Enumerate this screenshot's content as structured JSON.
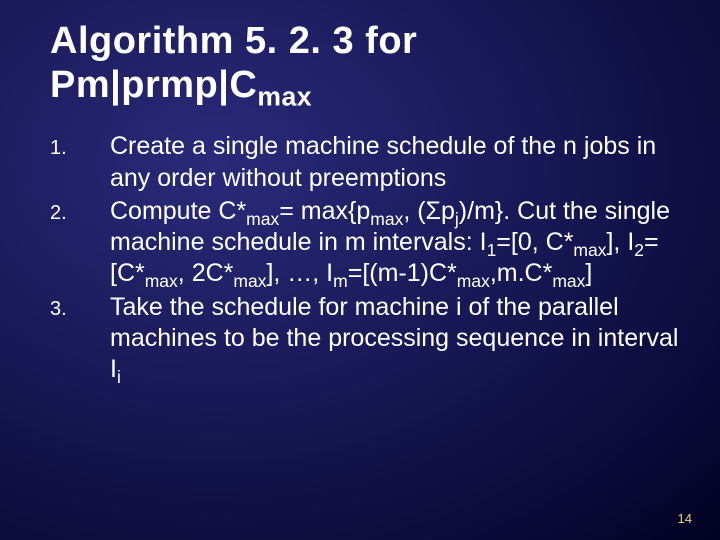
{
  "title_line1": "Algorithm 5. 2. 3 for",
  "title_line2_a": "Pm|prmp|C",
  "title_line2_sub": "max",
  "items": [
    {
      "num": "1.",
      "text": "Create a single machine schedule of the n jobs in any order without preemptions"
    },
    {
      "num": "2.",
      "text": "Compute C*max= max{pmax, (Σpj)/m}. Cut the single machine schedule in m intervals: I1=[0, C*max], I2= [C*max, 2C*max], …, Im=[(m-1)C*max,m.C*max]"
    },
    {
      "num": "3.",
      "text": "Take the schedule for machine i of the parallel machines to be the processing sequence in interval Ii"
    }
  ],
  "page_number": "14"
}
